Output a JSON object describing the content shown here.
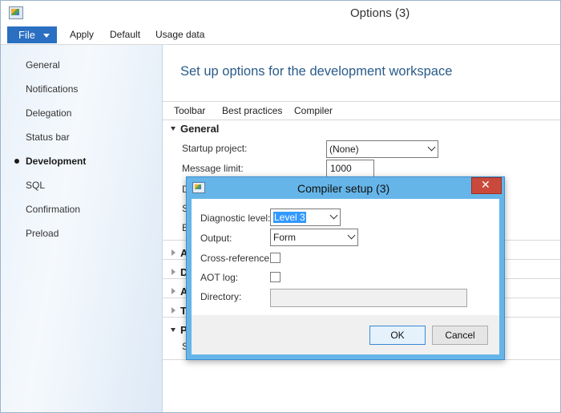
{
  "window": {
    "title": "Options (3)"
  },
  "menubar": {
    "file_label": "File",
    "items": [
      "Apply",
      "Default",
      "Usage data"
    ]
  },
  "sidebar": {
    "items": [
      {
        "label": "General"
      },
      {
        "label": "Notifications"
      },
      {
        "label": "Delegation"
      },
      {
        "label": "Status bar"
      },
      {
        "label": "Development",
        "active": true
      },
      {
        "label": "SQL"
      },
      {
        "label": "Confirmation"
      },
      {
        "label": "Preload"
      }
    ]
  },
  "main": {
    "heading": "Set up options for the development workspace",
    "tabs": [
      "Toolbar",
      "Best practices",
      "Compiler"
    ],
    "general_section": {
      "title": "General",
      "startup_project_label": "Startup project:",
      "startup_project_value": "(None)",
      "message_limit_label": "Message limit:",
      "message_limit_value": "1000",
      "partial_labels": [
        "D",
        "S",
        "E"
      ]
    },
    "collapsed_sections": [
      "A",
      "D",
      "A",
      "T"
    ],
    "expanded_section_partial": "P",
    "partial_row_label": "S"
  },
  "dialog": {
    "title": "Compiler setup (3)",
    "close_label": "✕",
    "diagnostic_level_label": "Diagnostic level:",
    "diagnostic_level_value": "Level 3",
    "output_label": "Output:",
    "output_value": "Form",
    "cross_reference_label": "Cross-reference:",
    "cross_reference_checked": false,
    "aot_log_label": "AOT log:",
    "aot_log_checked": false,
    "directory_label": "Directory:",
    "directory_value": "",
    "ok_label": "OK",
    "cancel_label": "Cancel"
  }
}
